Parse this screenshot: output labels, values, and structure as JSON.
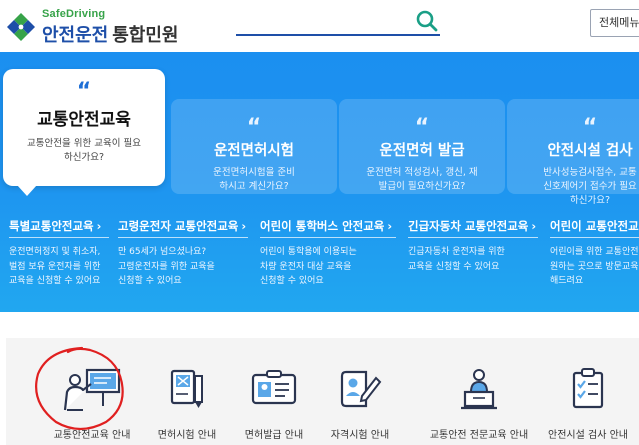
{
  "header": {
    "logo_en": "SafeDriving",
    "logo_ko": "안전운전",
    "logo_sub": "통합민원",
    "search_placeholder": "",
    "menu_button": "전체메뉴"
  },
  "featured": {
    "title": "교통안전교육",
    "desc": "교통안전을 위한 교육이 필요하신가요?"
  },
  "cards": [
    {
      "title": "운전면허시험",
      "desc": "운전면허시험을 준비하시고 계신가요?"
    },
    {
      "title": "운전면허 발급",
      "desc": "운전면허 적성검사, 갱신, 재발급이 필요하신가요?"
    },
    {
      "title": "안전시설 검사",
      "desc": "반사성능검사접수, 교통신호제어기 접수가 필요하신가요?"
    }
  ],
  "links": [
    {
      "title": "특별교통안전교육",
      "desc": [
        "운전면허정지 및 취소자,",
        "벌점 보유 운전자를 위한",
        "교육을 신청할 수 있어요"
      ]
    },
    {
      "title": "고령운전자 교통안전교육",
      "desc": [
        "만 65세가 넘으셨나요?",
        "고령운전자를 위한 교육을",
        "신청할 수 있어요"
      ]
    },
    {
      "title": "어린이 통학버스 안전교육",
      "desc": [
        "어린이 통학용에 이용되는",
        "차량 운전자 대상 교육을",
        "신청할 수 있어요"
      ]
    },
    {
      "title": "긴급자동차 교통안전교육",
      "desc": [
        "긴급자동차 운전자를 위한",
        "교육을 신청할 수 있어요"
      ]
    },
    {
      "title": "어린이 교통안전교",
      "desc": [
        "어린이를 위한 교통안전",
        "원하는 곳으로 방문교육",
        "해드려요"
      ]
    }
  ],
  "arrow_glyph": "›",
  "quote_glyph": "“",
  "services": [
    {
      "label": "교통안전교육 안내",
      "icon": "lecture-icon"
    },
    {
      "label": "면허시험 안내",
      "icon": "exam-pen-icon"
    },
    {
      "label": "면허발급 안내",
      "icon": "license-card-icon"
    },
    {
      "label": "자격시험 안내",
      "icon": "qualification-icon"
    },
    {
      "label": "교통안전 전문교육 안내",
      "icon": "instructor-icon"
    },
    {
      "label": "안전시설 검사 안내",
      "icon": "checklist-icon"
    }
  ],
  "colors": {
    "brand_blue": "#1e4fa8",
    "brand_green": "#37a349",
    "banner_blue": "#1b8ff0",
    "annotation_red": "#e02020"
  }
}
